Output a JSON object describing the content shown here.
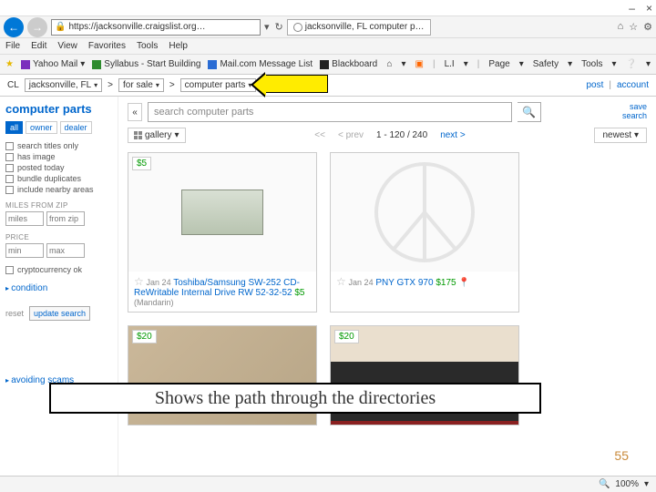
{
  "window": {
    "min": "–",
    "close": "×",
    "tab_title": "jacksonville, FL computer p…",
    "url": "https://jacksonville.craigslist.org…"
  },
  "menus": [
    "File",
    "Edit",
    "View",
    "Favorites",
    "Tools",
    "Help"
  ],
  "bookmarks": {
    "items": [
      "Yahoo Mail",
      "Syllabus - Start Building",
      "Mail.com Message List",
      "Blackboard"
    ]
  },
  "ie_tools": {
    "home": "⌂",
    "rss": "▣",
    "li": "L.I",
    "page": "Page",
    "safety": "Safety",
    "tools": "Tools",
    "help": "❔"
  },
  "breadcrumb": {
    "cl": "CL",
    "loc": "jacksonville, FL",
    "cat": "for sale",
    "sub": "computer parts",
    "post": "post",
    "account": "account"
  },
  "sidebar": {
    "heading": "computer parts",
    "tabs": {
      "all": "all",
      "owner": "owner",
      "dealer": "dealer"
    },
    "filters": {
      "titles": "search titles only",
      "image": "has image",
      "today": "posted today",
      "dup": "bundle duplicates",
      "nearby": "include nearby areas"
    },
    "miles_label": "MILES FROM ZIP",
    "miles_ph": "miles",
    "zip_ph": "from zip",
    "price_label": "PRICE",
    "min_ph": "min",
    "max_ph": "max",
    "crypto": "cryptocurrency ok",
    "condition": "condition",
    "reset": "reset",
    "update": "update search",
    "avoid": "avoiding scams"
  },
  "main": {
    "search_ph": "search computer parts",
    "save1": "save",
    "save2": "search",
    "view": "gallery",
    "prev2": "<<",
    "prev": "< prev",
    "range": "1 - 120 / 240",
    "next": "next >",
    "sort": "newest"
  },
  "cards": [
    {
      "price": "$5",
      "date": "Jan 24",
      "title": "Toshiba/Samsung SW-252 CD-ReWritable Internal Drive RW 52-32-52",
      "price2": "$5",
      "loc": "(Mandarin)"
    },
    {
      "price": "",
      "date": "Jan 24",
      "title": "PNY GTX 970",
      "price2": "$175"
    },
    {
      "price": "$20"
    },
    {
      "price": "$20"
    }
  ],
  "annotation": "Shows the path through the directories",
  "slide_no": "55",
  "status": {
    "zoom": "100%"
  }
}
